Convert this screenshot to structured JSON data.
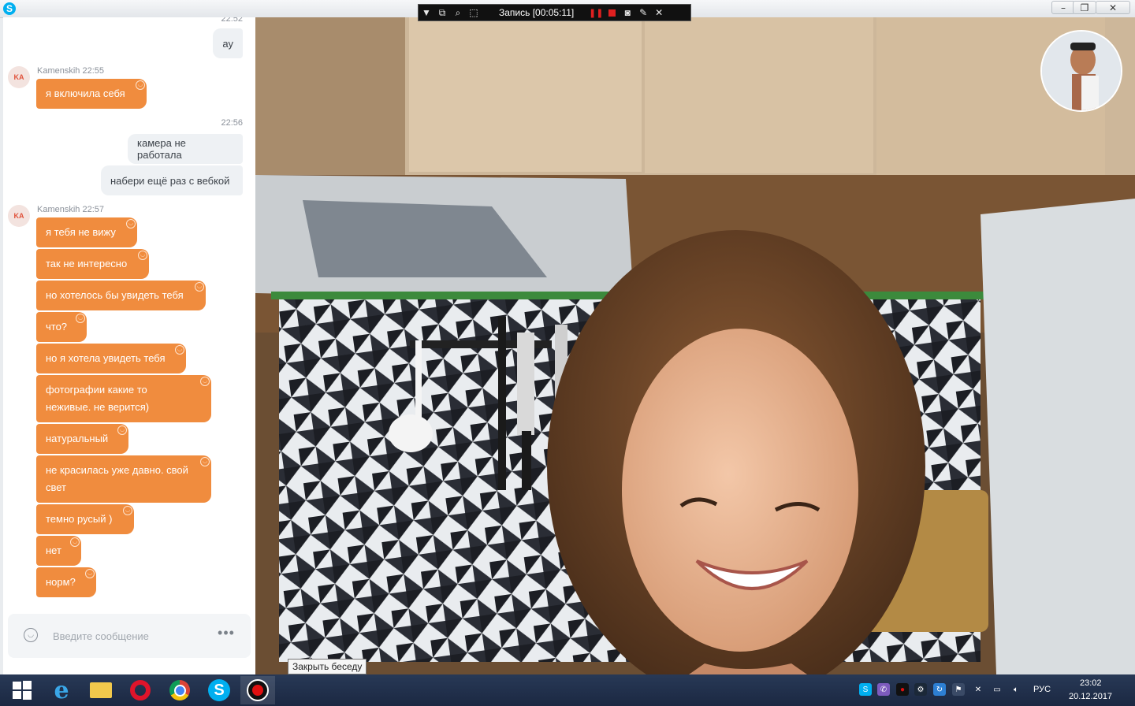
{
  "recorder": {
    "label": "Запись [00:05:11]"
  },
  "chat": {
    "messages_out_top": {
      "clipped_time": "22:52",
      "text": "ау"
    },
    "group1": {
      "avatar_initials": "KA",
      "sender": "Kamenskih 22:55",
      "messages": [
        "я включила себя"
      ]
    },
    "out_group": {
      "time": "22:56",
      "messages": [
        "камера не работала",
        "набери ещё раз с вебкой"
      ]
    },
    "group2": {
      "avatar_initials": "KA",
      "sender": "Kamenskih 22:57",
      "messages": [
        "я тебя не вижу",
        "так не интересно",
        "но хотелось бы увидеть тебя",
        "что?",
        "но я хотела увидеть тебя",
        "фотографии какие то неживые. не верится)",
        "натуральный",
        "не красилась уже давно. свой свет",
        "темно русый )",
        "нет",
        "норм?"
      ]
    },
    "composer": {
      "placeholder": "Введите сообщение",
      "more_label": "•••"
    }
  },
  "tooltip": "Закрыть беседу",
  "taskbar": {
    "language": "РУС",
    "time": "23:02",
    "date": "20.12.2017",
    "apps": [
      "windows-start",
      "internet-explorer",
      "file-explorer",
      "opera",
      "chrome",
      "skype",
      "recorder"
    ]
  },
  "colors": {
    "incoming_bubble": "#f08c3e",
    "outgoing_bubble": "#eef1f4",
    "taskbar": "#1f2f4a"
  }
}
